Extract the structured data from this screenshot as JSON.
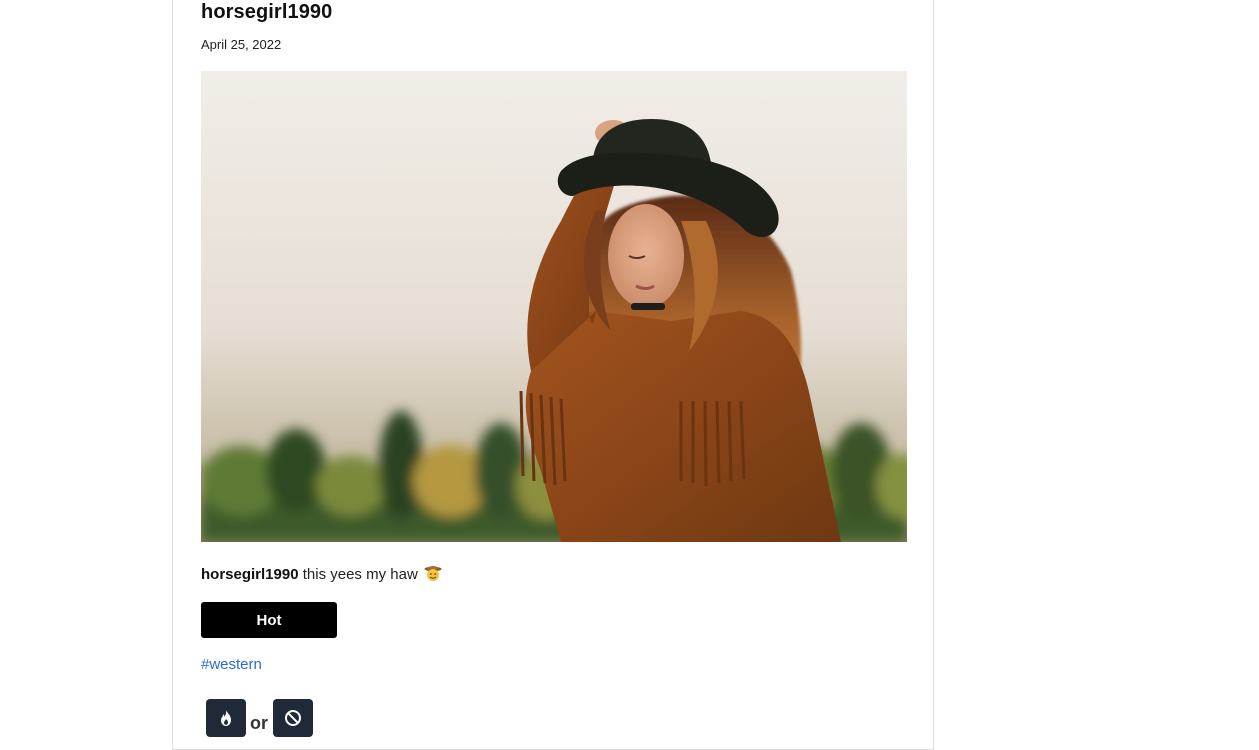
{
  "post": {
    "username": "horsegirl1990",
    "date": "April 25, 2022",
    "image_alt": "Woman with wavy hair wearing a black hat and brown fringed suede top in a field",
    "caption": {
      "username": "horsegirl1990",
      "text": "this yees my haw",
      "emoji": "cowboy-hat-face-emoji"
    },
    "badge_label": "Hot",
    "hashtag": "#western",
    "vote": {
      "hot_icon": "flame-icon",
      "or_label": "or",
      "not_icon": "prohibited-icon"
    }
  },
  "colors": {
    "badge_bg": "#000000",
    "vote_button_bg": "#1f2937",
    "hashtag": "#2a6bd6",
    "card_border": "#dddddd"
  }
}
